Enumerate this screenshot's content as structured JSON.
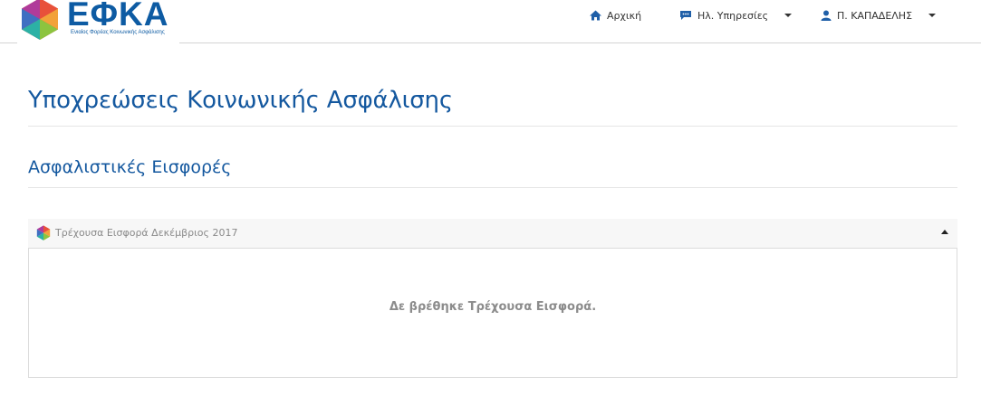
{
  "brand": {
    "name": "ΕΦΚΑ",
    "tagline": "Ενιαίος Φορέας Κοινωνικής Ασφάλισης",
    "color": "#0d5ba3"
  },
  "nav": {
    "home_label": "Αρχική",
    "eservices_label": "Ηλ. Υπηρεσίες",
    "user_label": "Π. ΚΑΠΑΔΕΛΗΣ"
  },
  "page": {
    "title": "Υποχρεώσεις Κοινωνικής Ασφάλισης",
    "section_title": "Ασφαλιστικές Εισφορές"
  },
  "panel": {
    "title": "Τρέχουσα Εισφορά Δεκέμβριος 2017",
    "empty_message": "Δε βρέθηκε Τρέχουσα Εισφορά.",
    "expanded": true
  },
  "colors": {
    "title_blue": "#14589f",
    "nav_icon_blue": "#1f5fa8"
  }
}
